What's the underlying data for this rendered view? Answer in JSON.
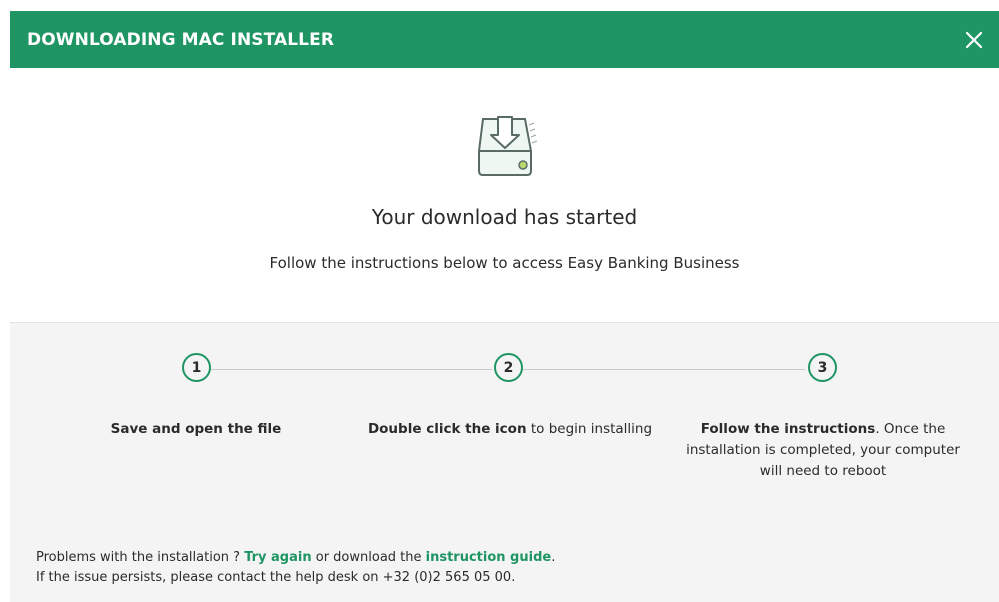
{
  "header": {
    "title": "DOWNLOADING MAC INSTALLER",
    "close_icon": "close-icon",
    "background_color": "#1f9563"
  },
  "hero": {
    "icon": "download-drive-icon",
    "headline": "Your download has started",
    "subline": "Follow the instructions below to access Easy Banking Business"
  },
  "steps": [
    {
      "number": "1",
      "bold": "Save and open the file",
      "rest": ""
    },
    {
      "number": "2",
      "bold": "Double click the icon",
      "rest": " to begin installing"
    },
    {
      "number": "3",
      "bold": "Follow the instructions",
      "rest": ". Once the installation is completed, your computer will need to reboot"
    }
  ],
  "footer": {
    "line1_prefix": "Problems with the installation ? ",
    "try_again": "Try again",
    "line1_middle": " or download the ",
    "instruction_guide": "instruction guide",
    "line1_suffix": ".",
    "line2": "If the issue persists, please contact the help desk on +32 (0)2 565 05 00."
  },
  "colors": {
    "accent": "#1f9563",
    "panel": "#f4f4f4",
    "text": "#2b2b2b"
  }
}
